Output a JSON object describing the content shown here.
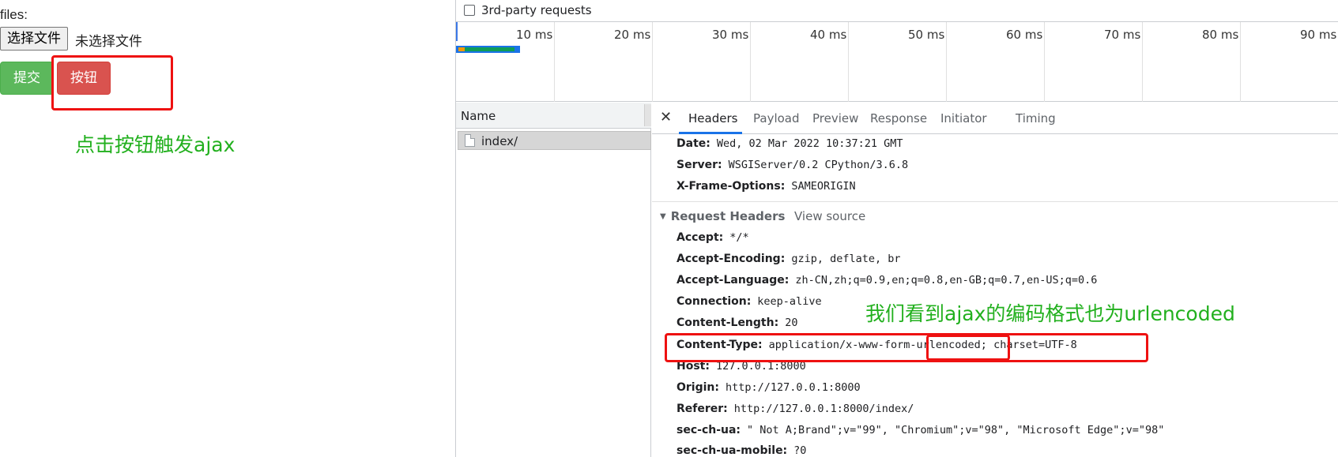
{
  "page": {
    "files_label": "files:",
    "choose_file_button": "选择文件",
    "no_file_text": "未选择文件",
    "submit_button": "提交",
    "red_button": "按钮",
    "annotation_left": "点击按钮触发ajax"
  },
  "devtools": {
    "third_party_checkbox": {
      "label": "3rd-party requests",
      "checked": false
    },
    "timeline_ticks": [
      "10 ms",
      "20 ms",
      "30 ms",
      "40 ms",
      "50 ms",
      "60 ms",
      "70 ms",
      "80 ms",
      "90 ms"
    ],
    "name_column": {
      "header": "Name",
      "rows": [
        "index/"
      ]
    },
    "tabs": [
      "Headers",
      "Payload",
      "Preview",
      "Response",
      "Initiator",
      "Timing"
    ],
    "active_tab": "Headers",
    "response_headers": [
      {
        "key": "Date:",
        "value": "Wed, 02 Mar 2022 10:37:21 GMT"
      },
      {
        "key": "Server:",
        "value": "WSGIServer/0.2 CPython/3.6.8"
      },
      {
        "key": "X-Frame-Options:",
        "value": "SAMEORIGIN"
      }
    ],
    "request_headers_title": "Request Headers",
    "view_source": "View source",
    "request_headers": [
      {
        "key": "Accept:",
        "value": "*/*"
      },
      {
        "key": "Accept-Encoding:",
        "value": "gzip, deflate, br"
      },
      {
        "key": "Accept-Language:",
        "value": "zh-CN,zh;q=0.9,en;q=0.8,en-GB;q=0.7,en-US;q=0.6"
      },
      {
        "key": "Connection:",
        "value": "keep-alive"
      },
      {
        "key": "Content-Length:",
        "value": "20"
      },
      {
        "key": "Content-Type:",
        "value": "application/x-www-form-urlencoded; charset=UTF-8"
      },
      {
        "key": "Host:",
        "value": "127.0.0.1:8000"
      },
      {
        "key": "Origin:",
        "value": "http://127.0.0.1:8000"
      },
      {
        "key": "Referer:",
        "value": "http://127.0.0.1:8000/index/"
      },
      {
        "key": "sec-ch-ua:",
        "value": "\" Not A;Brand\";v=\"99\", \"Chromium\";v=\"98\", \"Microsoft Edge\";v=\"98\""
      },
      {
        "key": "sec-ch-ua-mobile:",
        "value": "?0"
      }
    ],
    "annotation_right": "我们看到ajax的编码格式也为urlencoded"
  },
  "colors": {
    "success_green": "#5cb85c",
    "danger_red": "#d9534f",
    "annotation_green": "#22b01e",
    "highlight_red": "#ee1111",
    "tab_accent": "#1a73e8"
  }
}
